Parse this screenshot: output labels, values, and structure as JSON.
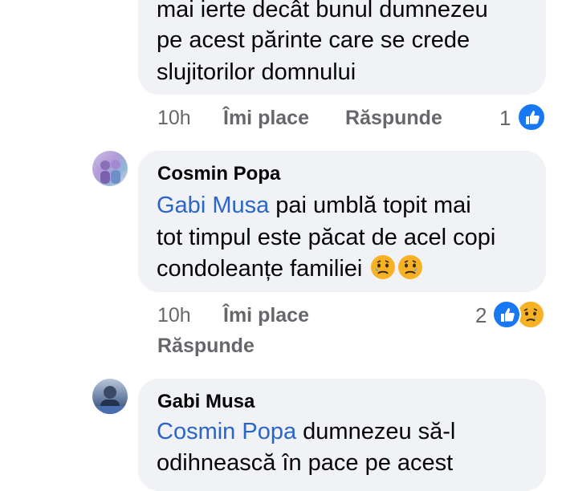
{
  "comments": [
    {
      "text_lines": [
        "mai ierte decât bunul dumnezeu",
        "pe acest părinte care se crede",
        "slujitorilor domnului"
      ],
      "time": "10h",
      "like_label": "Îmi place",
      "reply_label": "Răspunde",
      "reaction_count": "1",
      "reactions": [
        "like-icon"
      ]
    },
    {
      "author": "Cosmin Popa",
      "mention": "Gabi Musa",
      "line1_rest": " pai umblă topit mai",
      "line2": "tot timpul este păcat de acel copi",
      "line3": "condoleanțe familiei",
      "inline_emojis": [
        "crying-face-emoji",
        "crying-face-emoji"
      ],
      "time": "10h",
      "like_label": "Îmi place",
      "reply_label": "Răspunde",
      "reaction_count": "2",
      "reactions": [
        "like-icon",
        "sad-icon"
      ]
    },
    {
      "author": "Gabi Musa",
      "mention": "Cosmin Popa",
      "line1_rest": " dumnezeu să-l",
      "line2_partial": "odihnească în pace pe acest"
    }
  ],
  "colors": {
    "bubble": "#f0f2f5",
    "mention": "#2a66c9",
    "meta": "#65676b",
    "like_blue": "#1877f2",
    "sad_yellow": "#f7b125"
  }
}
